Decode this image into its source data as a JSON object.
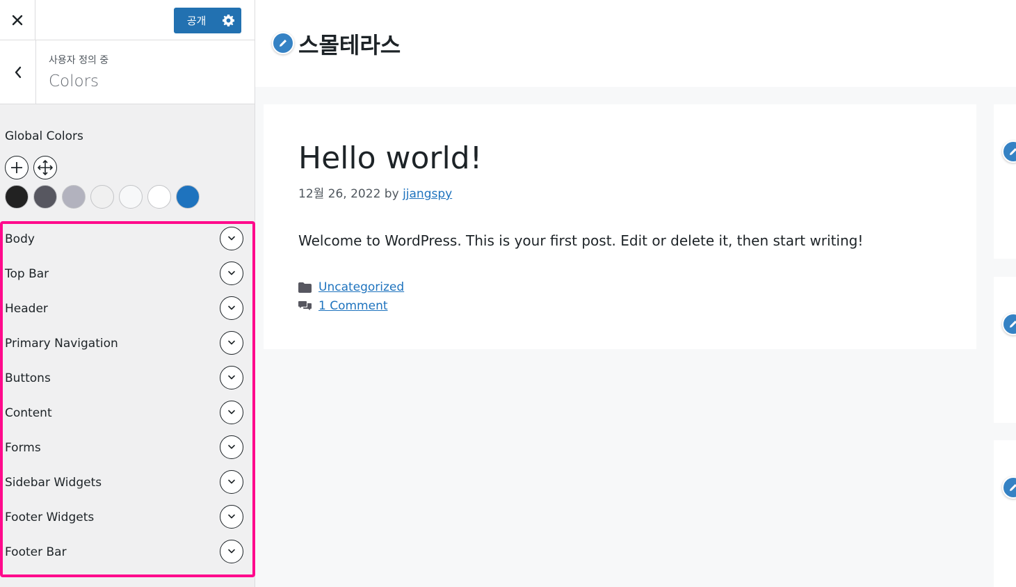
{
  "topbar": {
    "close_icon": "close-icon",
    "publish_label": "공개",
    "settings_icon": "gear-icon"
  },
  "section": {
    "subtitle": "사용자 정의 중",
    "title": "Colors",
    "back_icon": "chevron-left-icon"
  },
  "global_colors": {
    "label": "Global Colors",
    "tools": [
      "plus-icon",
      "move-icon"
    ],
    "swatches": [
      "#222222",
      "#575760",
      "#b2b2be",
      "#f0f0f0",
      "#f7f8f9",
      "#ffffff",
      "#1e73be"
    ]
  },
  "panels": [
    {
      "label": "Body"
    },
    {
      "label": "Top Bar"
    },
    {
      "label": "Header"
    },
    {
      "label": "Primary Navigation"
    },
    {
      "label": "Buttons"
    },
    {
      "label": "Content"
    },
    {
      "label": "Forms"
    },
    {
      "label": "Sidebar Widgets"
    },
    {
      "label": "Footer Widgets"
    },
    {
      "label": "Footer Bar"
    }
  ],
  "preview": {
    "site_title": "스몰테라스",
    "post": {
      "title": "Hello world!",
      "date": "12월 26, 2022",
      "by": "by",
      "author": "jjangspy",
      "body": "Welcome to WordPress. This is your first post. Edit or delete it, then start writing!",
      "category": "Uncategorized",
      "comments": "1 Comment"
    }
  },
  "colors": {
    "accent": "#2271b1",
    "highlight_border": "#ff0a8c",
    "link": "#1e73be",
    "edit_shortcut": "#3582c4"
  }
}
